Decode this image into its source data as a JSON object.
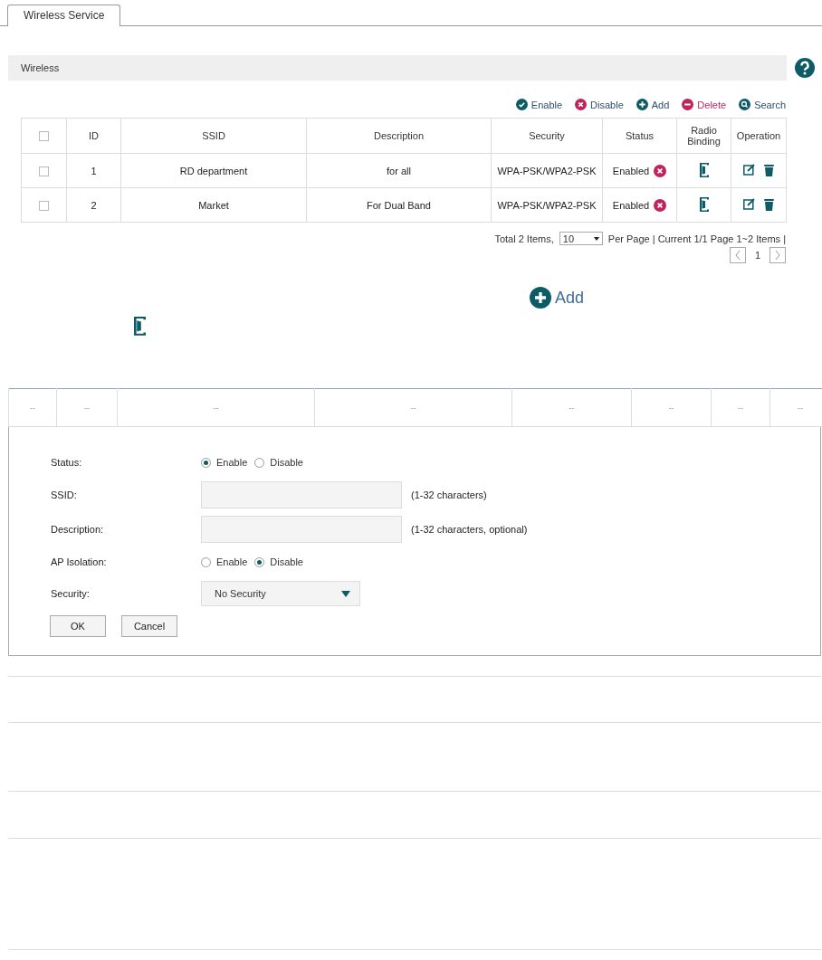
{
  "tabs": [
    {
      "label": "Wireless Service",
      "selected": true
    }
  ],
  "section": {
    "title": "Wireless"
  },
  "toolbar": [
    {
      "kind": "enable",
      "label": "Enable"
    },
    {
      "kind": "disable",
      "label": "Disable"
    },
    {
      "kind": "add",
      "label": "Add"
    },
    {
      "kind": "delete",
      "label": "Delete"
    },
    {
      "kind": "search",
      "label": "Search"
    }
  ],
  "table": {
    "select_all_checked": false,
    "columns": [
      "ID",
      "SSID",
      "Description",
      "Security",
      "Status",
      "Radio Binding",
      "Operation"
    ],
    "rows": [
      {
        "checked": false,
        "id": "1",
        "ssid": "RD department",
        "description": "for all",
        "security": "WPA-PSK/WPA2-PSK",
        "status": "Enabled"
      },
      {
        "checked": false,
        "id": "2",
        "ssid": "Market",
        "description": "For Dual Band",
        "security": "WPA-PSK/WPA2-PSK",
        "status": "Enabled"
      }
    ]
  },
  "pagination": {
    "total": "Total 2 Items,",
    "per_page": "10",
    "summary": "Per Page | Current 1/1 Page 1~2 Items |",
    "page": "1"
  },
  "add_button": {
    "label": "Add"
  },
  "empty_table": {
    "cells": [
      "--",
      "--",
      "--",
      "--",
      "--",
      "--",
      "--",
      "--"
    ]
  },
  "form": {
    "fields": [
      {
        "kind": "radio",
        "label": "Status:",
        "options": [
          {
            "label": "Enable",
            "selected": true
          },
          {
            "label": "Disable",
            "selected": false
          }
        ]
      },
      {
        "kind": "text",
        "label": "SSID:",
        "hint": "(1-32 characters)"
      },
      {
        "kind": "text",
        "label": "Description:",
        "hint": "(1-32 characters, optional)"
      },
      {
        "kind": "radio",
        "label": "AP Isolation:",
        "options": [
          {
            "label": "Enable",
            "selected": false
          },
          {
            "label": "Disable",
            "selected": true
          }
        ]
      },
      {
        "kind": "select",
        "label": "Security:",
        "value": "No Security"
      }
    ],
    "buttons": [
      "OK",
      "Cancel"
    ]
  }
}
